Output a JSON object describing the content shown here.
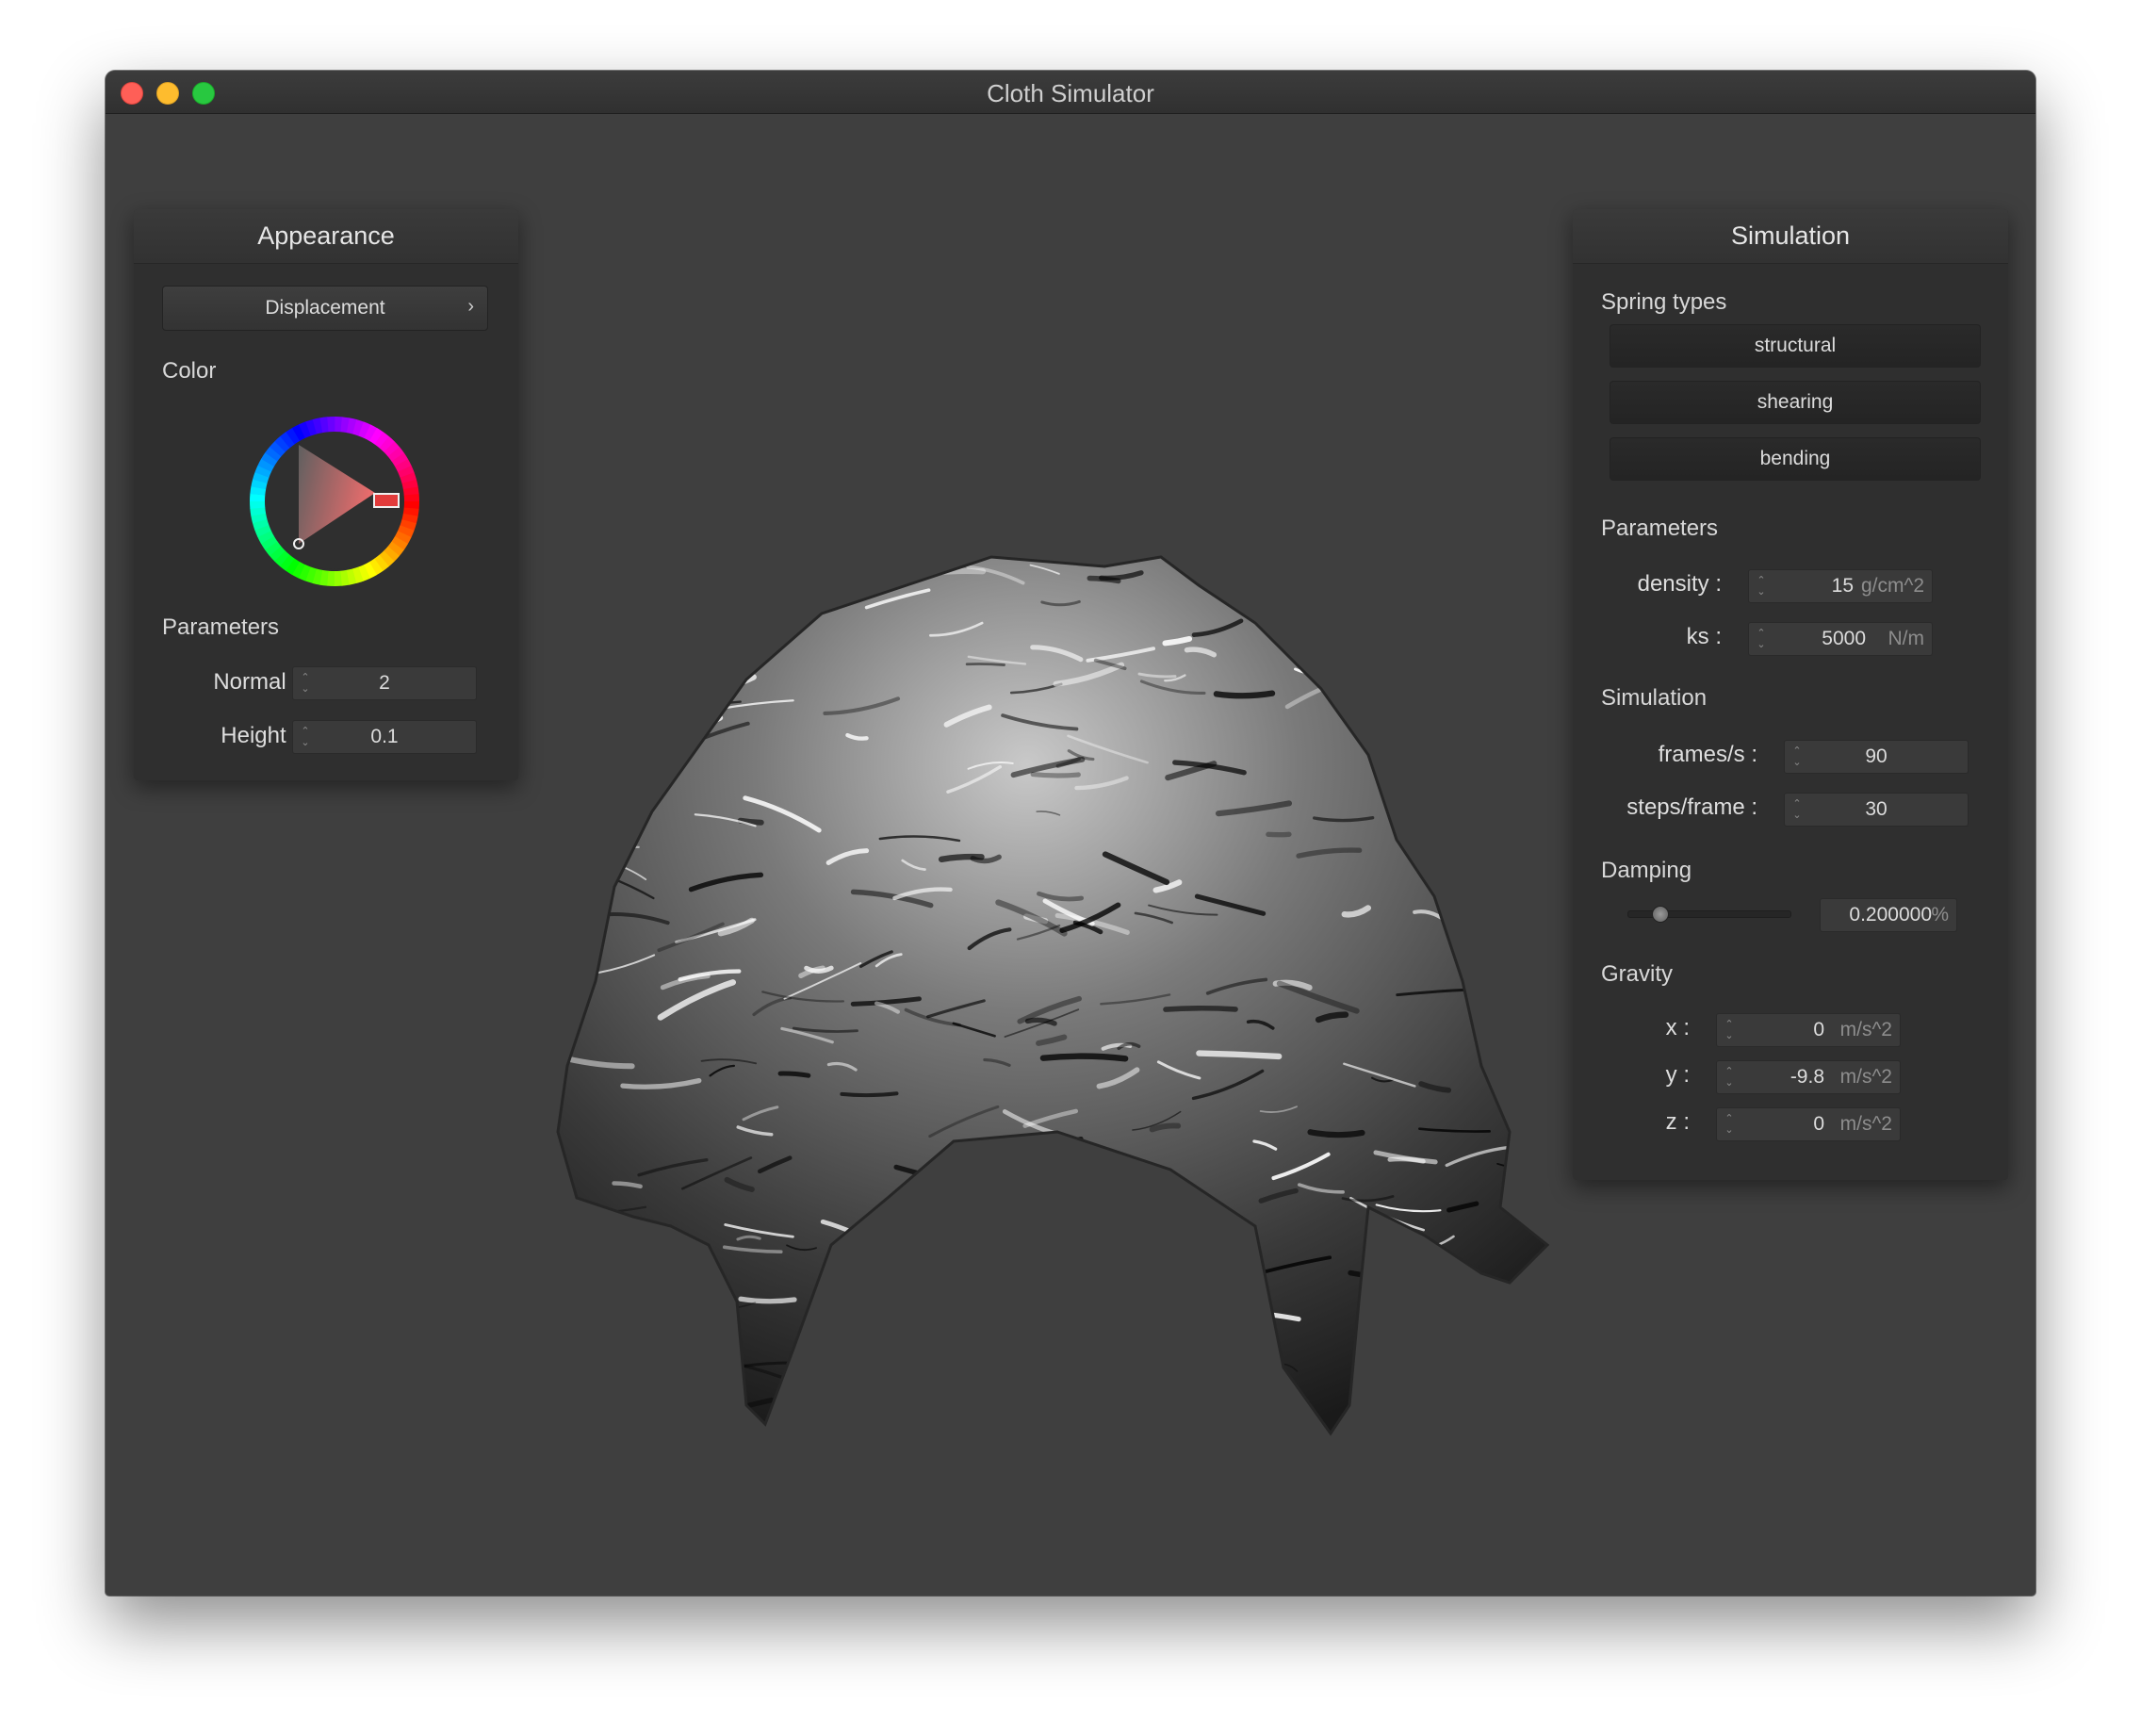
{
  "window": {
    "title": "Cloth Simulator"
  },
  "appearance": {
    "header": "Appearance",
    "shader_button": "Displacement",
    "color_label": "Color",
    "selected_color": "#e23b3b",
    "parameters_label": "Parameters",
    "normal": {
      "label": "Normal :",
      "value": "2"
    },
    "height": {
      "label": "Height :",
      "value": "0.1"
    }
  },
  "simulation_panel": {
    "header": "Simulation",
    "spring_types_label": "Spring types",
    "springs": [
      "structural",
      "shearing",
      "bending"
    ],
    "parameters_label": "Parameters",
    "density": {
      "label": "density :",
      "value": "15",
      "unit": "g/cm^2"
    },
    "ks": {
      "label": "ks :",
      "value": "5000",
      "unit": "N/m"
    },
    "simulation_label": "Simulation",
    "frames": {
      "label": "frames/s :",
      "value": "90"
    },
    "steps": {
      "label": "steps/frame :",
      "value": "30"
    },
    "damping_label": "Damping",
    "damping": {
      "value": "0.200000",
      "unit": "%",
      "slider_fraction": 0.2
    },
    "gravity_label": "Gravity",
    "gx": {
      "label": "x :",
      "value": "0",
      "unit": "m/s^2"
    },
    "gy": {
      "label": "y :",
      "value": "-9.8",
      "unit": "m/s^2"
    },
    "gz": {
      "label": "z :",
      "value": "0",
      "unit": "m/s^2"
    }
  },
  "icons": {
    "close": "close-button-icon",
    "minimize": "minimize-button-icon",
    "maximize": "maximize-button-icon",
    "chevron": "chevron-right-icon",
    "spinner": "up-down-spinner-icon"
  }
}
